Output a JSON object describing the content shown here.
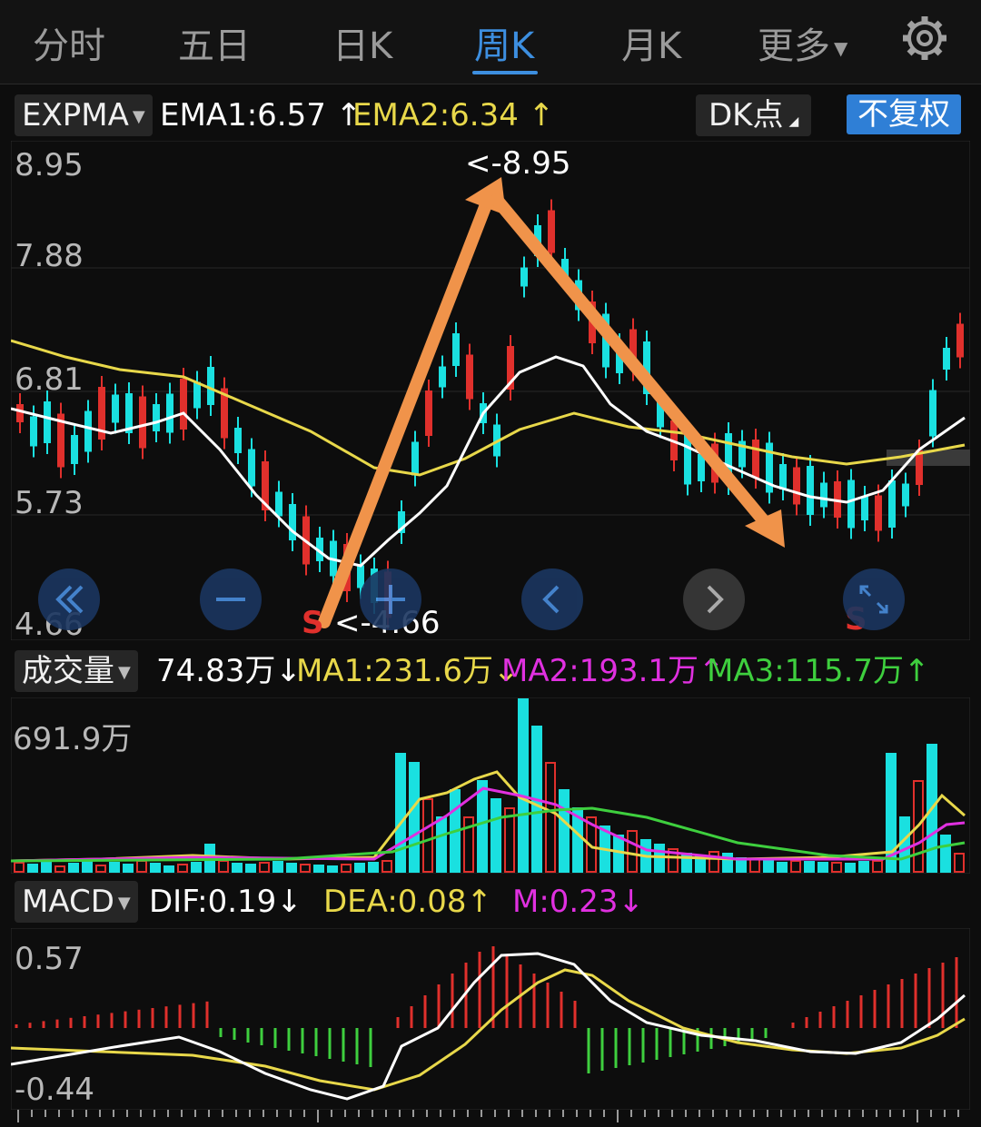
{
  "tabs": [
    "分时",
    "五日",
    "日K",
    "周K",
    "月K",
    "更多"
  ],
  "active_tab": "周K",
  "main_indicator": {
    "selector": "EXPMA",
    "ema1": "EMA1:6.57",
    "ema2": "EMA2:6.34",
    "dk_button": "DK点",
    "fq_button": "不复权",
    "price_high": "8.95",
    "price_2": "7.88",
    "price_3": "6.81",
    "price_4": "5.73",
    "price_low": "4.66",
    "high_marker": "<-8.95",
    "low_marker": "<-4.66",
    "signal_s": "S"
  },
  "volume": {
    "selector": "成交量",
    "current": "74.83万",
    "ma1": "MA1:231.6万",
    "ma2": "MA2:193.1万",
    "ma3": "MA3:115.7万",
    "max_label": "691.9万"
  },
  "macd": {
    "selector": "MACD",
    "dif": "DIF:0.19",
    "dea": "DEA:0.08",
    "m": "M:0.23",
    "top_label": "0.57",
    "bottom_label": "-0.44"
  },
  "colors": {
    "up": "#e0302c",
    "down": "#1ae0e0",
    "ema1": "#ffffff",
    "ema2": "#e8d84a",
    "ma2": "#e030e0",
    "ma3": "#3ecf3e",
    "accent": "#3d8fe0",
    "arrow": "#f0934a"
  },
  "icons": [
    "settings-gear-icon",
    "double-left-icon",
    "zoom-out-icon",
    "zoom-in-icon",
    "left-icon",
    "right-icon",
    "fullscreen-icon"
  ]
}
